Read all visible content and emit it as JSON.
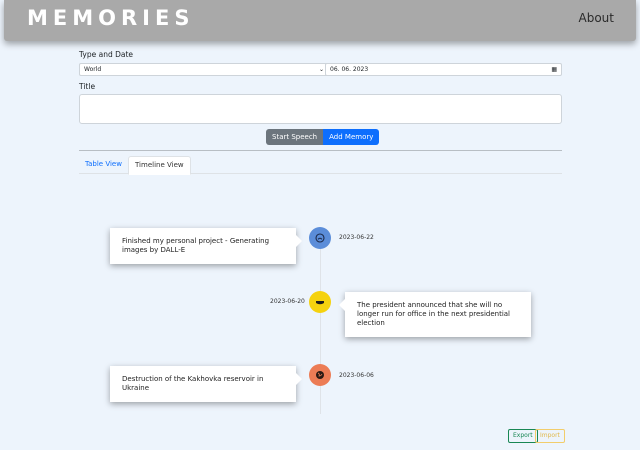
{
  "nav": {
    "brand": "MEMORIES",
    "about": "About"
  },
  "form": {
    "type_date_label": "Type and Date",
    "type_value": "World",
    "date_value": "06. 06. 2023",
    "title_label": "Title",
    "title_value": "",
    "start_speech": "Start Speech",
    "add_memory": "Add Memory"
  },
  "tabs": [
    {
      "label": "Table View",
      "active": false
    },
    {
      "label": "Timeline View",
      "active": true
    }
  ],
  "timeline": [
    {
      "date": "2023-06-22",
      "text": "Finished my personal project - Generating images by DALL-E",
      "icon": "personal-icon",
      "color": "#5b8dd9"
    },
    {
      "date": "2023-06-20",
      "text": "The president announced that she will no longer run for office in the next presidential election",
      "icon": "politics-icon",
      "color": "#f5d20f"
    },
    {
      "date": "2023-06-06",
      "text": "Destruction of the Kakhovka reservoir in Ukraine",
      "icon": "world-icon",
      "color": "#ec7c55"
    }
  ],
  "footer": {
    "export": "Export",
    "import": "Import"
  },
  "colors": {
    "primary": "#0d6efd",
    "secondary": "#6c757d",
    "navbar": "#a9a9a9",
    "background": "#edf4fc"
  }
}
